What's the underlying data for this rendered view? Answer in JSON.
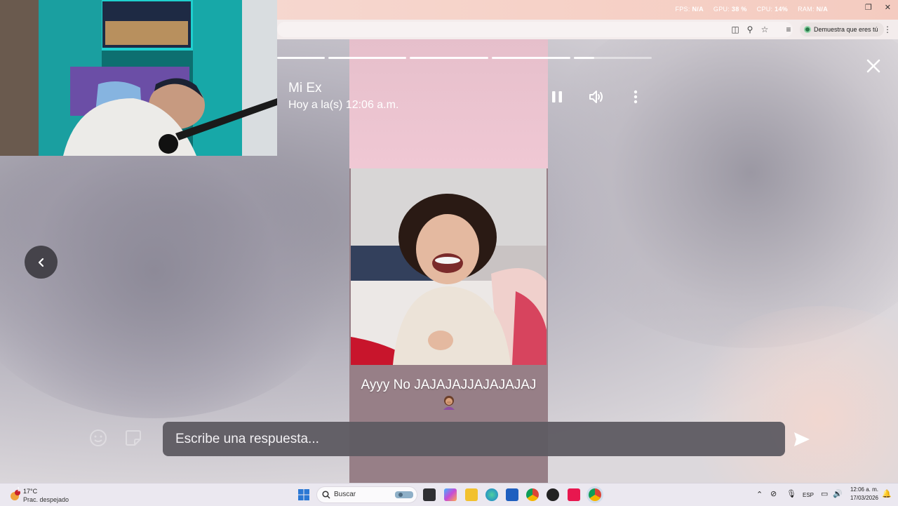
{
  "browser": {
    "perf": [
      {
        "label": "FPS:",
        "value": "N/A"
      },
      {
        "label": "GPU:",
        "value": "38 %"
      },
      {
        "label": "CPU:",
        "value": "14%"
      },
      {
        "label": "RAM:",
        "value": "N/A"
      }
    ],
    "verify_label": "Demuestra que eres tú"
  },
  "story": {
    "poster_name": "Mi Ex",
    "timestamp": "Hoy a la(s) 12:06 a.m.",
    "caption": "Ayyy No JAJAJAJJAJAJAJAJ",
    "progress_segments": [
      1,
      1,
      1,
      1,
      0.25,
      0
    ]
  },
  "reply": {
    "placeholder": "Escribe una respuesta..."
  },
  "taskbar": {
    "weather_temp": "17°C",
    "weather_desc": "Prac. despejado",
    "weather_badge": "1",
    "search_label": "Buscar",
    "lang": "ESP",
    "time": "12:06 a. m.",
    "date": "17/03/2026"
  },
  "colors": {
    "story_bg": "#977f87",
    "story_top": "#f0c8d4",
    "reply_bg": "#5f5c63",
    "taskbar_bg": "#ebe8f0",
    "webcam_led": "#18c4c4"
  }
}
